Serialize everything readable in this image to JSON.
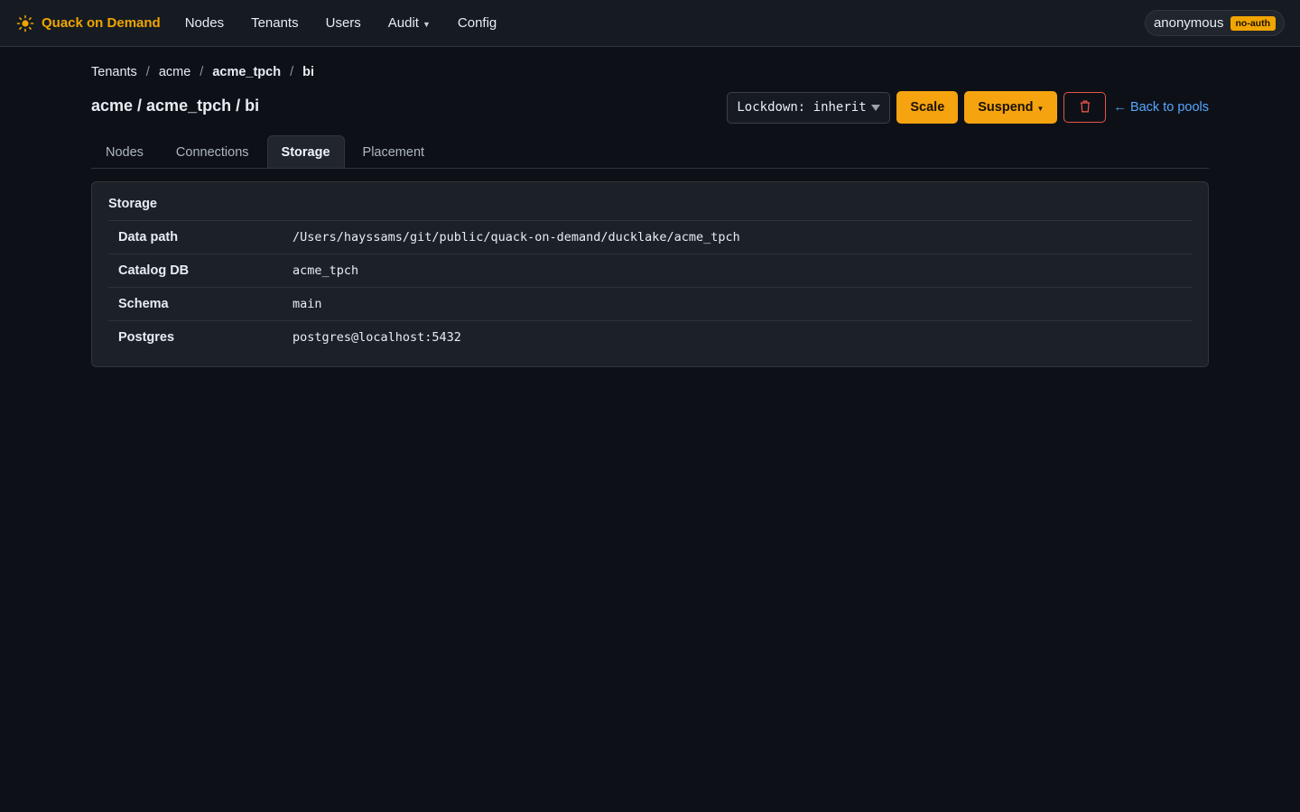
{
  "brand": {
    "name": "Quack on Demand",
    "icon": "sun-icon",
    "color": "#f0a500"
  },
  "nav": {
    "items": [
      {
        "label": "Nodes"
      },
      {
        "label": "Tenants"
      },
      {
        "label": "Users"
      },
      {
        "label": "Audit",
        "has_dropdown": true
      },
      {
        "label": "Config"
      }
    ]
  },
  "user": {
    "name": "anonymous",
    "badge": "no-auth"
  },
  "breadcrumb": [
    "Tenants",
    "acme",
    "acme_tpch",
    "bi"
  ],
  "page": {
    "title": "acme / acme_tpch / bi"
  },
  "actions": {
    "lockdown_label": "Lockdown: inherit",
    "scale_label": "Scale",
    "suspend_label": "Suspend",
    "delete_icon": "trash-icon",
    "back_label": "← Back to pools"
  },
  "tabs": [
    {
      "label": "Nodes",
      "active": false
    },
    {
      "label": "Connections",
      "active": false
    },
    {
      "label": "Storage",
      "active": true
    },
    {
      "label": "Placement",
      "active": false
    }
  ],
  "storage": {
    "title": "Storage",
    "rows": [
      {
        "key": "Data path",
        "value": "/Users/hayssams/git/public/quack-on-demand/ducklake/acme_tpch"
      },
      {
        "key": "Catalog DB",
        "value": "acme_tpch"
      },
      {
        "key": "Schema",
        "value": "main"
      },
      {
        "key": "Postgres",
        "value": "postgres@localhost:5432"
      }
    ]
  },
  "colors": {
    "accent": "#f5a30f",
    "link": "#58a6ff",
    "danger": "#e5534b",
    "background": "#0d1117"
  }
}
